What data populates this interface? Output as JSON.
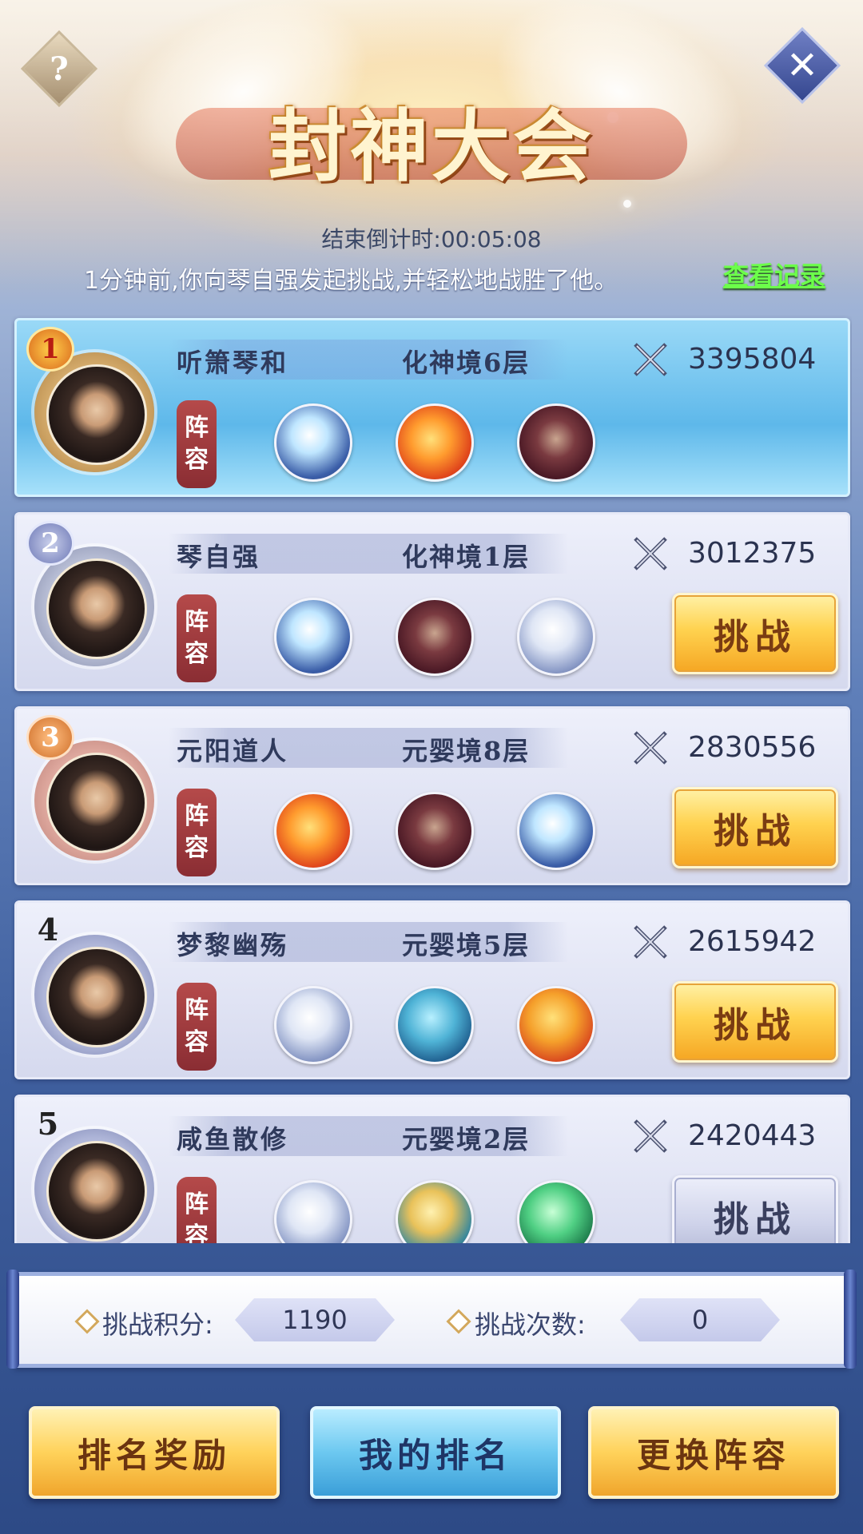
{
  "header": {
    "title": "封神大会",
    "countdown_label": "结束倒计时:",
    "countdown_value": "00:05:08",
    "notice": "1分钟前,你向琴自强发起挑战,并轻松地战胜了他。",
    "record_link": "查看记录",
    "help_symbol": "?",
    "close_symbol": "✕"
  },
  "team_label": [
    "阵",
    "容"
  ],
  "players": [
    {
      "rank": "1",
      "name": "听箫琴和",
      "realm": "化神境6层",
      "power": "3395804",
      "frame": "gold",
      "badge": "gold",
      "pets": [
        "pet-ice-dragon",
        "pet-phoenix",
        "pet-demon"
      ],
      "challenge": null
    },
    {
      "rank": "2",
      "name": "琴自强",
      "realm": "化神境1层",
      "power": "3012375",
      "frame": "silver",
      "badge": "silver",
      "pets": [
        "pet-ice-dragon",
        "pet-demon",
        "pet-white-tiger"
      ],
      "challenge": "挑战"
    },
    {
      "rank": "3",
      "name": "元阳道人",
      "realm": "元婴境8层",
      "power": "2830556",
      "frame": "bronze",
      "badge": "bronze",
      "pets": [
        "pet-phoenix",
        "pet-demon",
        "pet-ice-dragon"
      ],
      "challenge": "挑战"
    },
    {
      "rank": "4",
      "name": "梦黎幽殇",
      "realm": "元婴境5层",
      "power": "2615942",
      "frame": "plain",
      "badge": "number",
      "pets": [
        "pet-white-tiger",
        "pet-whale",
        "pet-fire-dragon"
      ],
      "challenge": "挑战"
    },
    {
      "rank": "5",
      "name": "咸鱼散修",
      "realm": "元婴境2层",
      "power": "2420443",
      "frame": "plain",
      "badge": "number",
      "pets": [
        "pet-white-tiger",
        "pet-golden-dragon",
        "pet-green-dragon"
      ],
      "challenge": "挑战",
      "challenge_disabled": true
    }
  ],
  "stats": {
    "points_label": "挑战积分:",
    "points_value": "1190",
    "attempts_label": "挑战次数:",
    "attempts_value": "0"
  },
  "buttons": {
    "rank_reward": "排名奖励",
    "my_rank": "我的排名",
    "change_team": "更换阵容"
  }
}
